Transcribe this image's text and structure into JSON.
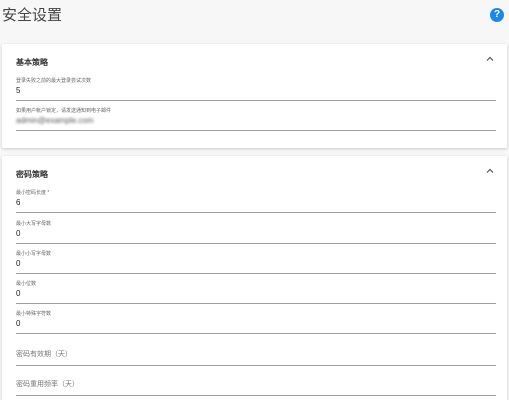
{
  "page": {
    "title": "安全设置"
  },
  "help_icon": {
    "glyph": "?",
    "icon": "help-circle-icon",
    "color": "#1e88e5"
  },
  "basic_policy": {
    "title": "基本策略",
    "fields": [
      {
        "label": "登录失败之前的最大登录尝试次数",
        "value": "5"
      },
      {
        "label": "如果用户帐户锁定，请发送通知到电子邮件",
        "value": "admin@example.com"
      }
    ]
  },
  "password_policy": {
    "title": "密码策略",
    "fields": [
      {
        "label": "最小密码长度 *",
        "value": "6"
      },
      {
        "label": "最小大写字母数",
        "value": "0"
      },
      {
        "label": "最小小写字母数",
        "value": "0"
      },
      {
        "label": "最小位数",
        "value": "0"
      },
      {
        "label": "最小特殊字符数",
        "value": "0"
      }
    ],
    "placeholders": [
      {
        "placeholder": "密码有效期（天）"
      },
      {
        "placeholder": "密码重用频率（天）"
      }
    ]
  }
}
